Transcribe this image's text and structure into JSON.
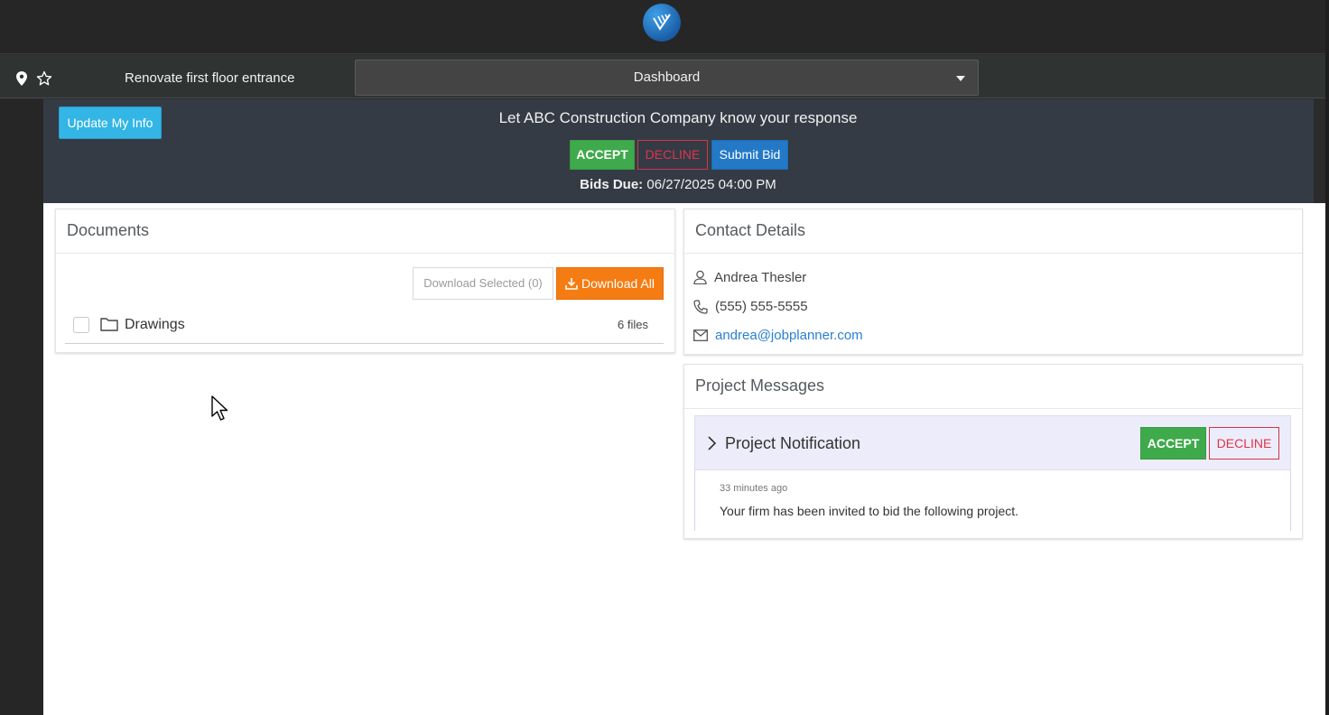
{
  "header": {
    "project_name": "Renovate first floor entrance",
    "view_select": "Dashboard"
  },
  "banner": {
    "update_label": "Update My Info",
    "title": "Let ABC Construction Company know your response",
    "accept_label": "ACCEPT",
    "decline_label": "DECLINE",
    "submit_bid_label": "Submit Bid",
    "bids_due_label": "Bids Due:",
    "bids_due_value": "06/27/2025 04:00 PM"
  },
  "documents": {
    "title": "Documents",
    "download_selected_label": "Download Selected (0)",
    "download_all_label": "Download All",
    "folders": [
      {
        "name": "Drawings",
        "count": "6 files"
      }
    ]
  },
  "contact": {
    "title": "Contact Details",
    "name": "Andrea Thesler",
    "phone": "(555) 555-5555",
    "email": "andrea@jobplanner.com"
  },
  "messages": {
    "title": "Project Messages",
    "items": [
      {
        "title": "Project Notification",
        "accept_label": "ACCEPT",
        "decline_label": "DECLINE",
        "time": "33 minutes ago",
        "body": "Your firm has been invited to bid the following project."
      }
    ]
  },
  "colors": {
    "accept": "#3faa4b",
    "decline": "#e0344a",
    "submit_bid": "#2479c7",
    "download_all": "#f57c13",
    "update_info": "#33b5e5",
    "banner_bg": "#343b45"
  }
}
